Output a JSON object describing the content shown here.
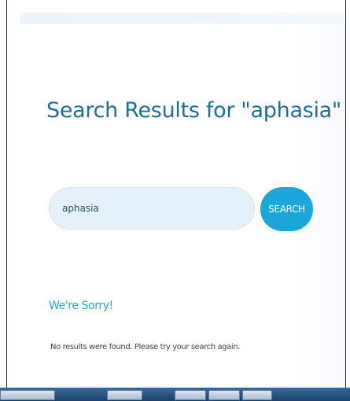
{
  "page": {
    "title": "Search Results for \"aphasia\""
  },
  "search": {
    "value": "aphasia",
    "button_label": "SEARCH"
  },
  "results": {
    "heading": "We're Sorry!",
    "message": "No results were found. Please try your search again."
  },
  "colors": {
    "title": "#1f6f95",
    "accent": "#1ca7da",
    "input_bg": "#e4f1fa",
    "sorry": "#24a6d2"
  }
}
